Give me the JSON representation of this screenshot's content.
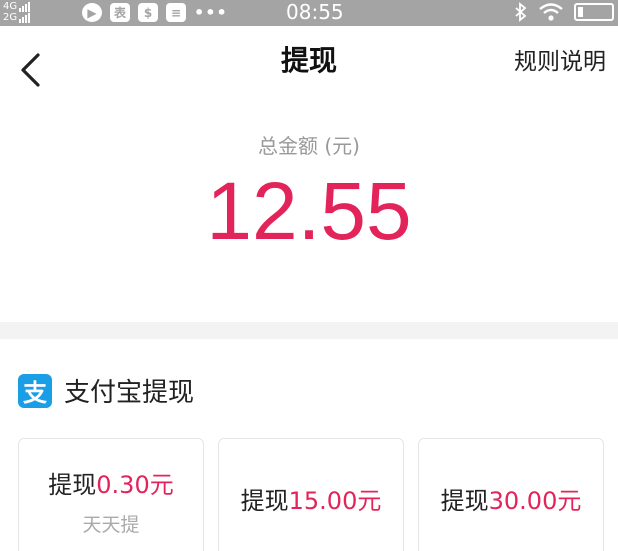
{
  "status_bar": {
    "network_top": "4G",
    "network_bottom": "2G",
    "time": "08:55",
    "dots": "•••"
  },
  "nav": {
    "title": "提现",
    "rules_link": "规则说明"
  },
  "summary": {
    "total_label": "总金额 (元)",
    "total_amount": "12.55"
  },
  "alipay": {
    "icon_glyph": "支",
    "title": "支付宝提现"
  },
  "options": [
    {
      "prefix": "提现",
      "amount": "0.30元",
      "note": "天天提"
    },
    {
      "prefix": "提现",
      "amount": "15.00元"
    },
    {
      "prefix": "提现",
      "amount": "30.00元"
    }
  ],
  "colors": {
    "accent": "#e2245a",
    "alipay_blue": "#1a9ee6",
    "status_bar": "#a4a4a4"
  }
}
